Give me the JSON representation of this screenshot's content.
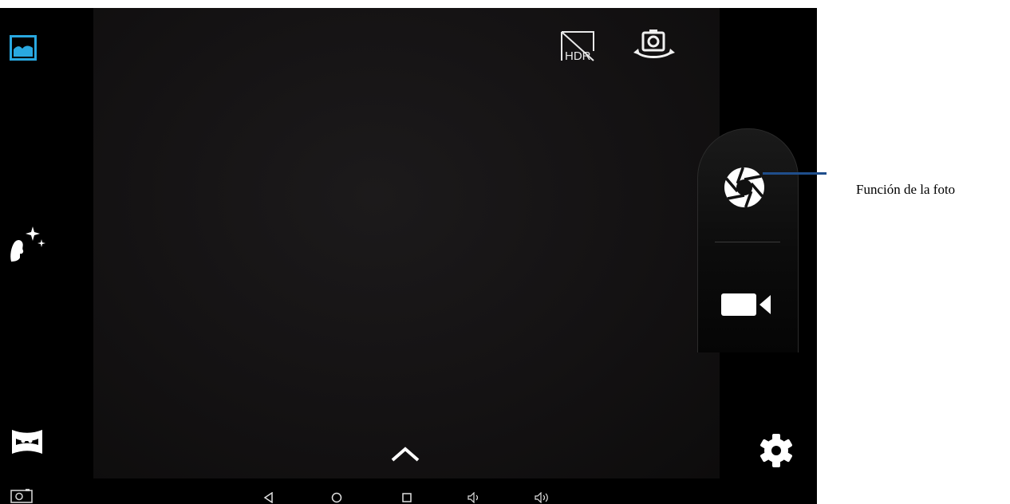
{
  "top_controls": {
    "hdr_label": "HDR"
  },
  "left_rail": {
    "items": [
      {
        "name": "gallery",
        "icon": "gallery-icon",
        "active": true
      },
      {
        "name": "beauty",
        "icon": "face-sparkle-icon"
      },
      {
        "name": "panorama",
        "icon": "panorama-icon"
      }
    ]
  },
  "right_controls": {
    "shutter_icon": "shutter-icon",
    "video_icon": "video-camera-icon",
    "settings_icon": "gear-icon"
  },
  "navbar": {
    "items": [
      "back-icon",
      "home-icon",
      "recents-icon",
      "volume-down-icon",
      "volume-up-icon"
    ]
  },
  "annotation": {
    "label": "Función de la foto"
  },
  "colors": {
    "accent": "#29a8e0",
    "callout": "#1f4e8c",
    "background": "#000000"
  }
}
